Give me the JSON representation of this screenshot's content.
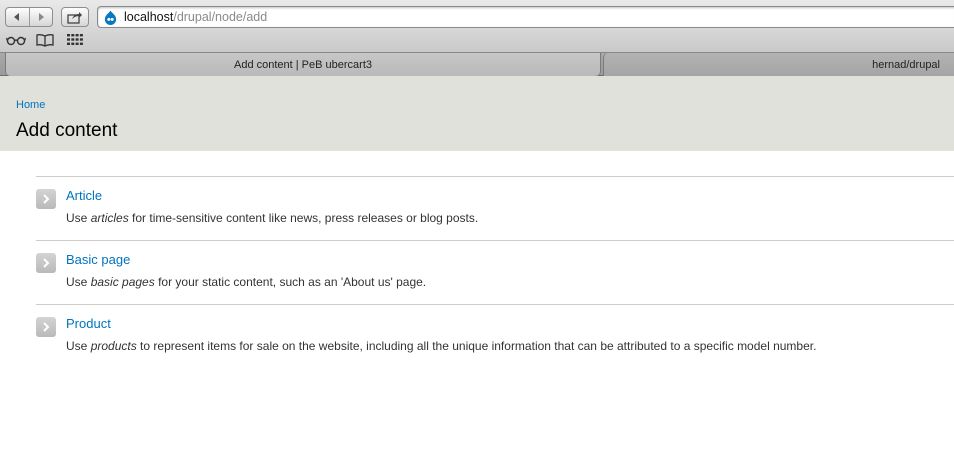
{
  "browser": {
    "url_host": "localhost",
    "url_path": "/drupal/node/add",
    "tabs": [
      {
        "title": "Add content | PeB ubercart3",
        "active": true
      },
      {
        "title": "hernad/drupal",
        "active": false
      }
    ]
  },
  "page": {
    "breadcrumb": "Home",
    "title": "Add content"
  },
  "content_types": [
    {
      "name": "Article",
      "desc_pre": "Use ",
      "desc_em": "articles",
      "desc_post": " for time-sensitive content like news, press releases or blog posts."
    },
    {
      "name": "Basic page",
      "desc_pre": "Use ",
      "desc_em": "basic pages",
      "desc_post": " for your static content, such as an 'About us' page."
    },
    {
      "name": "Product",
      "desc_pre": "Use ",
      "desc_em": "products",
      "desc_post": " to represent items for sale on the website, including all the unique information that can be attributed to a specific model number."
    }
  ],
  "icons": {
    "back": "back-arrow-icon",
    "forward": "forward-arrow-icon",
    "share": "share-icon",
    "favicon": "drupal-drop-icon",
    "reading_list": "glasses-icon",
    "bookmarks": "book-icon",
    "top_sites": "grid-icon",
    "list_item": "chevron-right-icon"
  },
  "colors": {
    "link": "#0074bd",
    "header_bg": "#e1e1db"
  }
}
